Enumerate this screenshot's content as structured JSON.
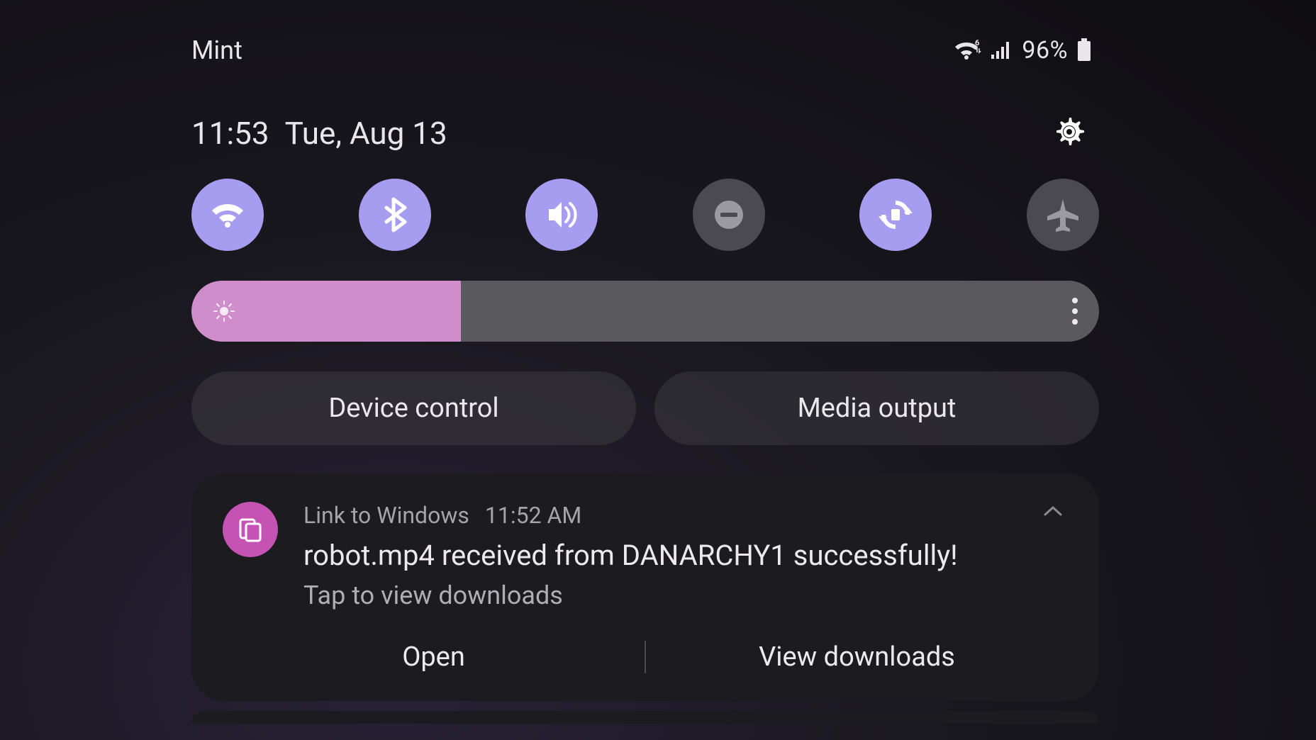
{
  "status": {
    "carrier": "Mint",
    "battery_pct": "96%"
  },
  "clock": {
    "time": "11:53",
    "date": "Tue, Aug 13"
  },
  "quick_settings": [
    {
      "name": "wifi",
      "on": true
    },
    {
      "name": "bluetooth",
      "on": true
    },
    {
      "name": "sound",
      "on": true
    },
    {
      "name": "dnd",
      "on": false
    },
    {
      "name": "rotate",
      "on": true
    },
    {
      "name": "airplane",
      "on": false
    }
  ],
  "brightness": {
    "percent": 30
  },
  "pills": {
    "device_control": "Device control",
    "media_output": "Media output"
  },
  "notification": {
    "app": "Link to Windows",
    "time": "11:52 AM",
    "title": "robot.mp4 received from DANARCHY1 successfully!",
    "body": "Tap to view downloads",
    "actions": {
      "open": "Open",
      "view": "View downloads"
    }
  },
  "colors": {
    "accent_active": "#a79df0",
    "accent_inactive": "#4a4a50",
    "brightness_fill": "#d08dcb",
    "notif_icon": "#c553b4"
  }
}
